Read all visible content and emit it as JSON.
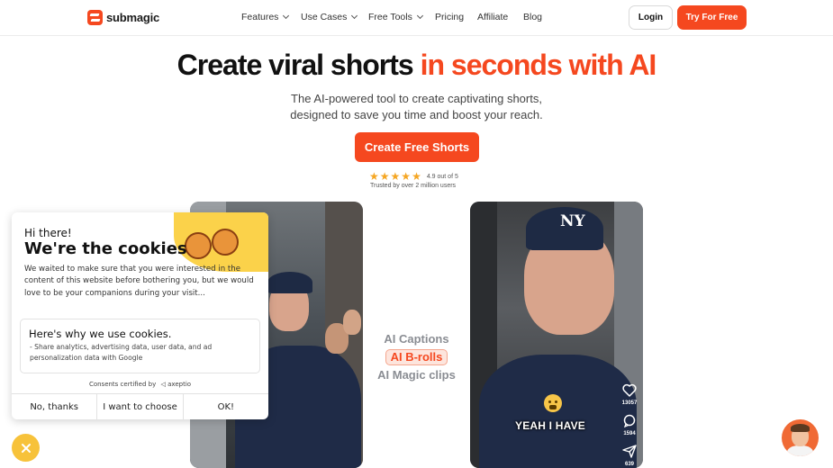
{
  "nav": {
    "brand": "submagic",
    "links": [
      {
        "label": "Features",
        "dropdown": true
      },
      {
        "label": "Use Cases",
        "dropdown": true
      },
      {
        "label": "Free Tools",
        "dropdown": true
      },
      {
        "label": "Pricing",
        "dropdown": false
      },
      {
        "label": "Affiliate",
        "dropdown": false
      },
      {
        "label": "Blog",
        "dropdown": false
      }
    ],
    "login_label": "Login",
    "try_label": "Try For Free"
  },
  "hero": {
    "headline_part1": "Create viral shorts",
    "headline_part2": "in seconds with AI",
    "sub_line1": "The AI-powered tool to create captivating shorts,",
    "sub_line2": "designed to save you time and boost your reach.",
    "cta_label": "Create Free Shorts",
    "rating_value": 4.9,
    "rating_text": "4.9 out of 5",
    "trusted_text": "Trusted by over 2 million users"
  },
  "features": [
    "AI Captions",
    "AI B-rolls",
    "AI Magic clips"
  ],
  "video_right": {
    "caption": "YEAH I HAVE",
    "likes": "13057",
    "comments": "1594",
    "shares": "639"
  },
  "cookie": {
    "greeting": "Hi there!",
    "title": "We're the cookies",
    "description": "We waited to make sure that you were interested in the content of this website before bothering you, but we would love to be your companions during your visit...",
    "why_title": "Here's why we use cookies.",
    "why_item": "- Share analytics, advertising data, user data, and ad personalization data with Google",
    "certified": "Consents certified by",
    "certifier": "axeptio",
    "buttons": [
      "No, thanks",
      "I want to choose",
      "OK!"
    ]
  },
  "colors": {
    "brand_orange": "#f5481f",
    "star_yellow": "#f5a623",
    "cookie_yellow": "#f7c23a"
  },
  "icons": [
    "heart-icon",
    "comment-icon",
    "share-icon",
    "close-icon",
    "star-icon",
    "axeptio-icon"
  ]
}
